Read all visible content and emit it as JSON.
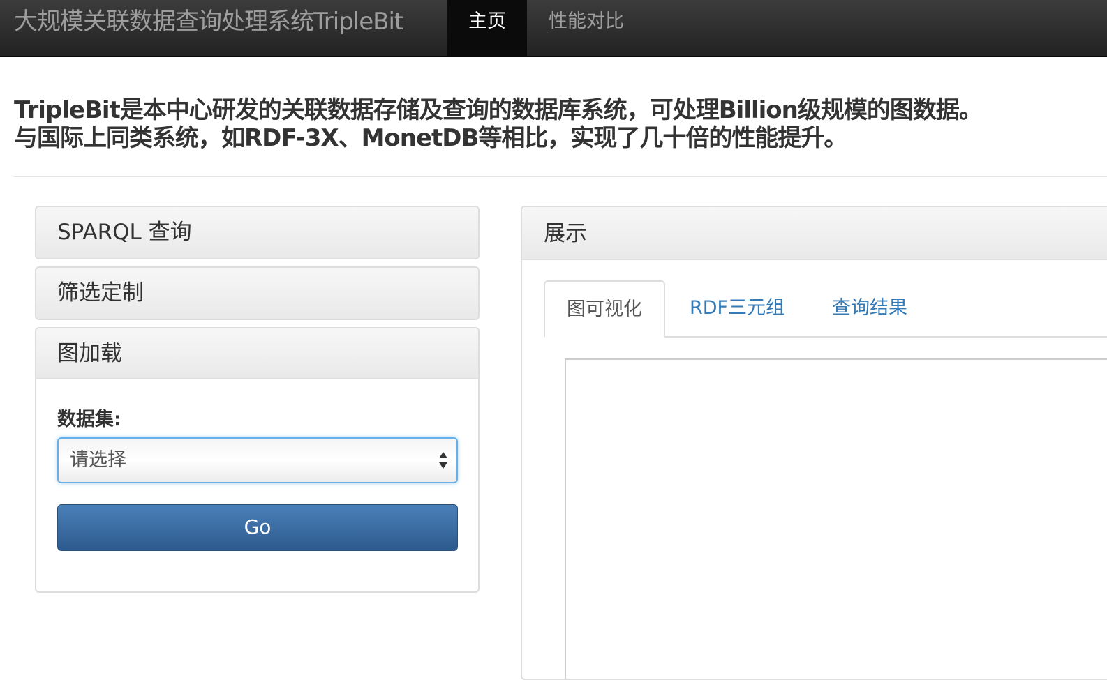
{
  "navbar": {
    "brand": "大规模关联数据查询处理系统TripleBit",
    "items": [
      {
        "label": "主页",
        "active": true
      },
      {
        "label": "性能对比",
        "active": false
      }
    ]
  },
  "intro": {
    "line1": "TripleBit是本中心研发的关联数据存储及查询的数据库系统，可处理Billion级规模的图数据。",
    "line2": "与国际上同类系统，如RDF-3X、MonetDB等相比，实现了几十倍的性能提升。"
  },
  "accordion": {
    "sparql_title": "SPARQL 查询",
    "filter_title": "筛选定制",
    "load_title": "图加载",
    "dataset_label": "数据集:",
    "dataset_select": {
      "value": "请选择"
    },
    "go_label": "Go"
  },
  "display": {
    "title": "展示",
    "tabs": [
      {
        "label": "图可视化",
        "active": true
      },
      {
        "label": "RDF三元组",
        "active": false
      },
      {
        "label": "查询结果",
        "active": false
      }
    ]
  },
  "colors": {
    "navbar_bg": "#222222",
    "link": "#337ab7",
    "primary_button": "#3a6ea5",
    "focus_border": "#66afe9"
  }
}
